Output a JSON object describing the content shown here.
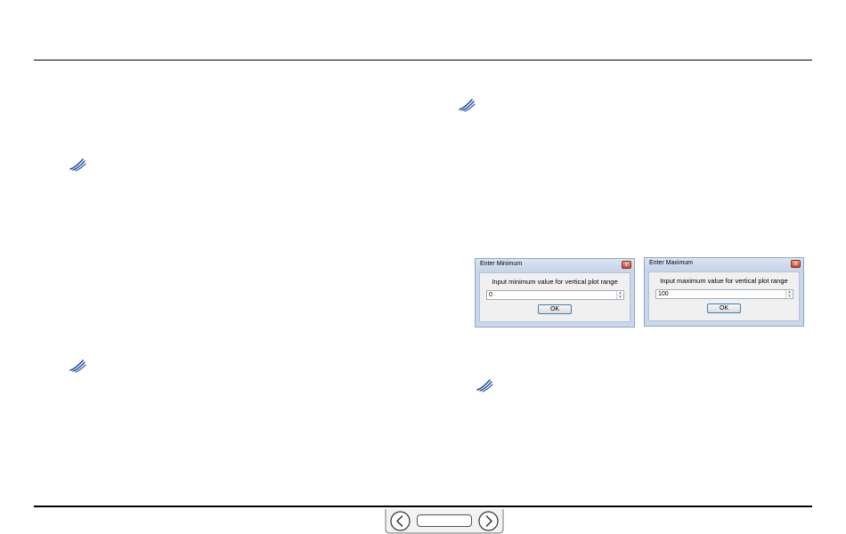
{
  "dialogs": [
    {
      "title": "Enter Minimum",
      "prompt": "Input minimum value for vertical plot range",
      "value": "0",
      "ok_label": "OK",
      "close_glyph": "x"
    },
    {
      "title": "Enter Maximum",
      "prompt": "Input maximum value for vertical plot range",
      "value": "100",
      "ok_label": "OK",
      "close_glyph": "x"
    }
  ],
  "icons": {
    "bullet": "swoosh-bullet-icon",
    "prev": "chevron-left-icon",
    "next": "chevron-right-icon",
    "spin_up": "spin-up-arrow-icon",
    "spin_down": "spin-down-arrow-icon"
  },
  "colors": {
    "bullet_blue": "#1f4e9c",
    "dialog_frame": "#c9d7ea",
    "ok_border": "#3c7fb1",
    "close_red": "#c6442b"
  },
  "nav": {
    "page_label": ""
  }
}
